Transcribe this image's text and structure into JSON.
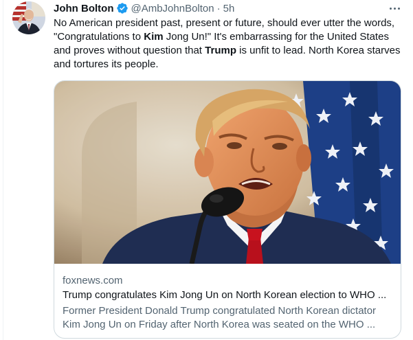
{
  "tweet": {
    "author_name": "John Bolton",
    "handle": "@AmbJohnBolton",
    "separator": "·",
    "time": "5h",
    "text_segments": [
      {
        "text": "No American president past, present or future, should ever utter the words, \"Congratulations to "
      },
      {
        "text": "Kim",
        "bold": true
      },
      {
        "text": " Jong Un!\"  It's embarrassing for the United States and proves without question that "
      },
      {
        "text": "Trump",
        "bold": true
      },
      {
        "text": " is unfit to lead.  North Korea starves and tortures its people."
      }
    ]
  },
  "card": {
    "domain": "foxnews.com",
    "title": "Trump congratulates Kim Jong Un on North Korean election to WHO ...",
    "description": "Former President Donald Trump congratulated North Korean dictator Kim Jong Un on Friday after North Korea was seated on the WHO ..."
  },
  "icons": {
    "verified": "verified-badge-icon",
    "more": "more-options-icon"
  },
  "colors": {
    "text_primary": "#0f1419",
    "text_secondary": "#536471",
    "verified_blue": "#1d9bf0",
    "border": "#cfd9de"
  }
}
